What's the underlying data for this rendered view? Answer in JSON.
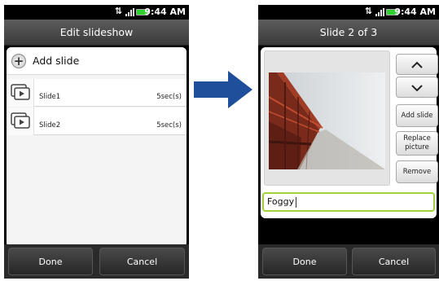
{
  "status": {
    "time": "9:44 AM"
  },
  "edit_screen": {
    "title": "Edit slideshow",
    "add_slide_label": "Add slide",
    "slides": [
      {
        "name": "Slide1",
        "duration": "5sec(s)"
      },
      {
        "name": "Slide2",
        "duration": "5sec(s)"
      }
    ],
    "done_label": "Done",
    "cancel_label": "Cancel"
  },
  "slide_screen": {
    "title": "Slide 2 of 3",
    "add_slide_label": "Add slide",
    "replace_picture_label": "Replace picture",
    "remove_label": "Remove",
    "caption_value": "Foggy",
    "done_label": "Done",
    "cancel_label": "Cancel"
  },
  "colors": {
    "arrow": "#1f4e9a",
    "caption_focus": "#9fd33b"
  }
}
